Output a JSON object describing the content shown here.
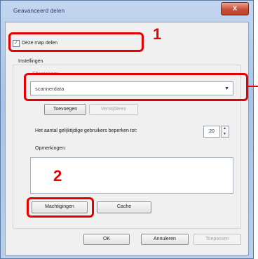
{
  "window": {
    "title": "Geavanceerd delen",
    "close_label": "X"
  },
  "share_checkbox": {
    "label": "Deze map delen",
    "checked": true
  },
  "settings": {
    "group_label": "Instellingen",
    "share_name_label": "Sharenaam:",
    "share_name_value": "scannerdata",
    "add_button": "Toevoegen",
    "remove_button": "Verwijderen",
    "user_limit_label": "Het aantal gelijktijdige gebruikers beperken tot:",
    "user_limit_value": "20",
    "comments_label": "Opmerkingen:",
    "comments_value": ""
  },
  "buttons": {
    "permissions": "Machtigingen",
    "caching": "Cache",
    "ok": "OK",
    "cancel": "Annuleren",
    "apply": "Toepassen"
  },
  "annotations": {
    "step1": "1",
    "step2": "2",
    "color": "#e40000"
  }
}
